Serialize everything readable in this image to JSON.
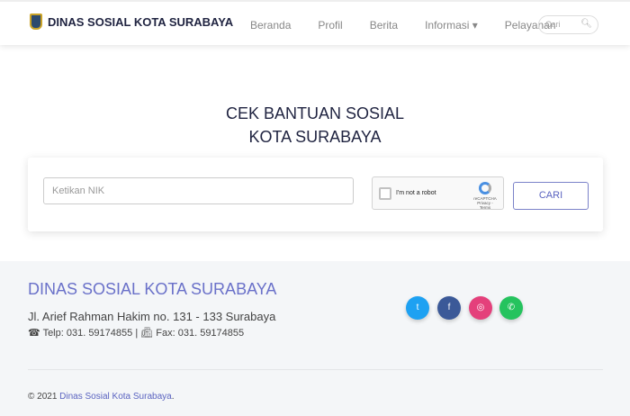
{
  "nav": {
    "brand": "DINAS SOSIAL KOTA SURABAYA",
    "items": [
      "Beranda",
      "Profil",
      "Berita",
      "Informasi ▾",
      "Pelayanan"
    ],
    "search_placeholder": "Cari"
  },
  "main": {
    "title_line1": "CEK BANTUAN SOSIAL",
    "title_line2": "KOTA SURABAYA",
    "nik_placeholder": "Ketikan NIK",
    "captcha_label": "I'm not a robot",
    "captcha_brand": "reCAPTCHA",
    "captcha_links": "Privacy - Terms",
    "button": "CARI"
  },
  "footer": {
    "title": "DINAS SOSIAL KOTA SURABAYA",
    "address": "Jl. Arief Rahman Hakim no. 131 - 133 Surabaya",
    "phone": "Telp: 031. 59174855",
    "fax": "Fax: 031. 59174855",
    "copyright": "© 2021 ",
    "copyright_link": "Dinas Sosial Kota Surabaya",
    "period": ".",
    "social": [
      {
        "name": "twitter",
        "color": "#1da1f2"
      },
      {
        "name": "facebook",
        "color": "#3b5998"
      },
      {
        "name": "instagram",
        "color": "#e4407b"
      },
      {
        "name": "whatsapp",
        "color": "#25c35e"
      }
    ]
  }
}
